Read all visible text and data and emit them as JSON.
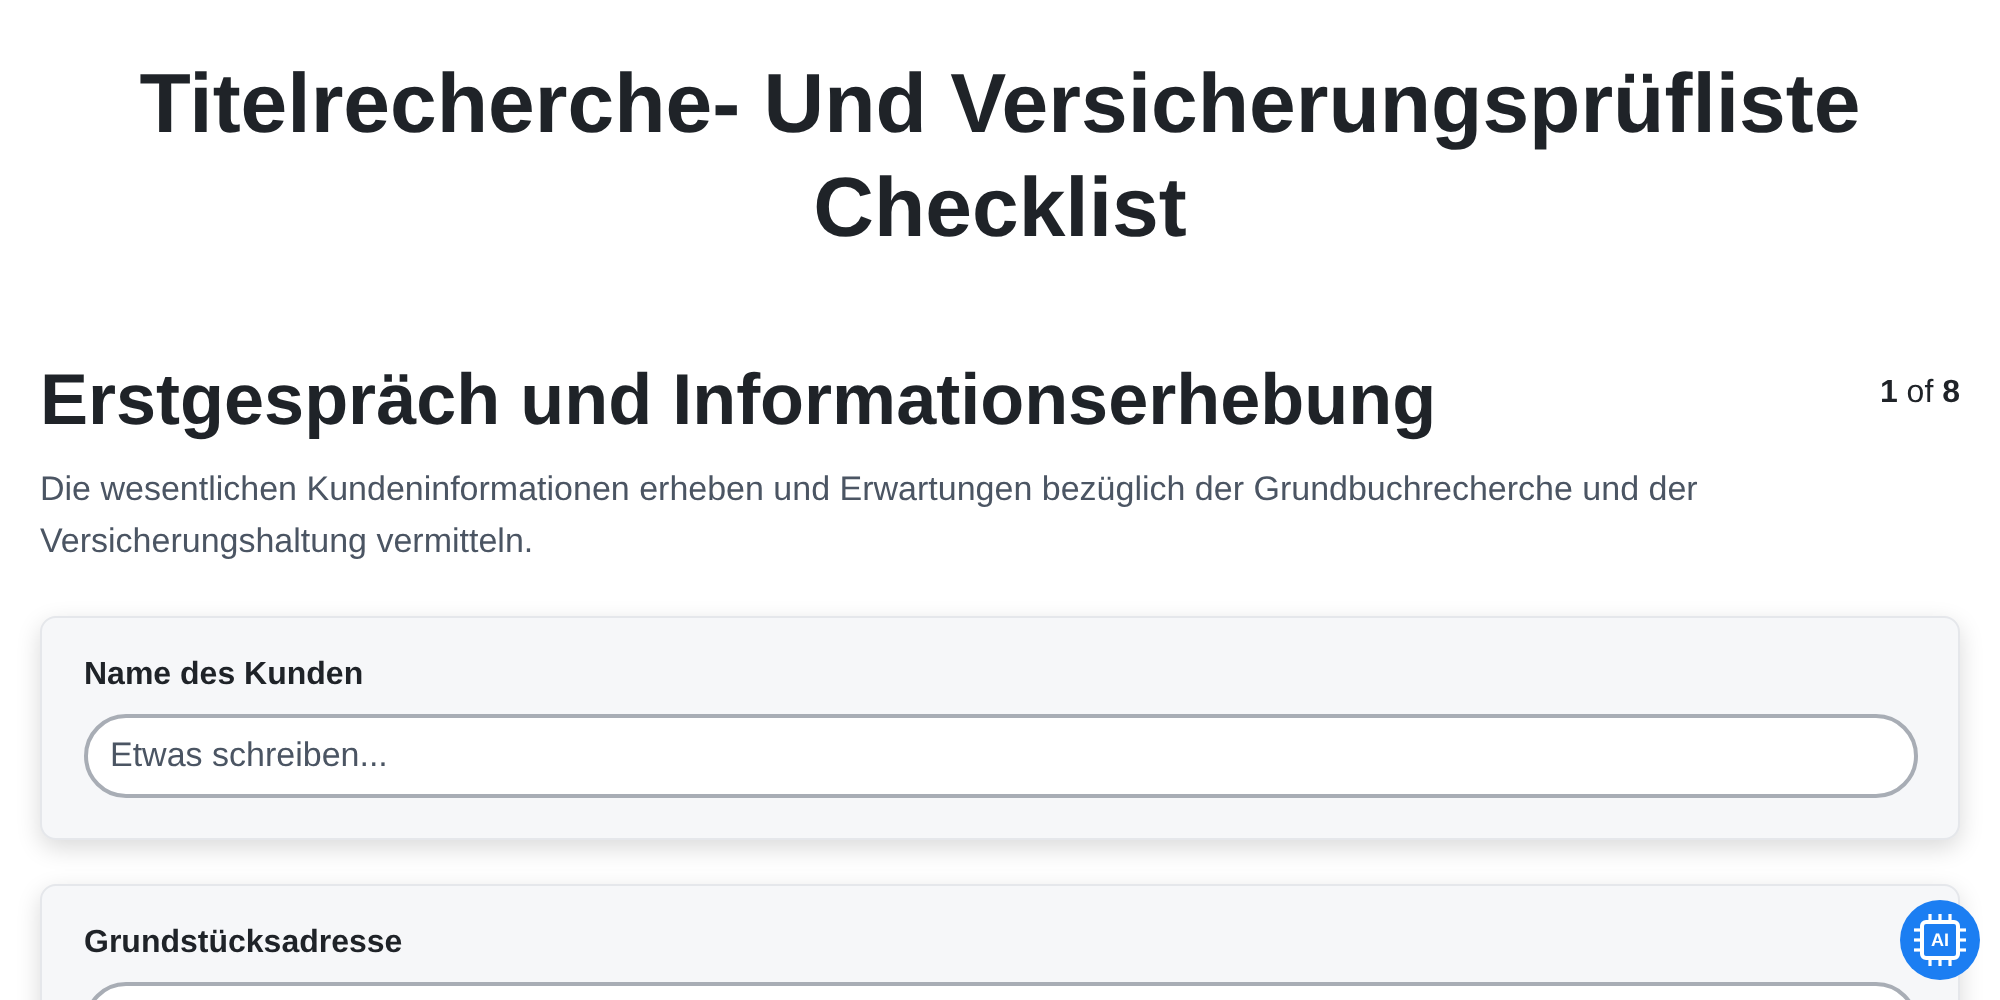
{
  "title": "Titelrecherche- Und Versicherungsprüfliste Checklist",
  "section": {
    "heading": "Erstgespräch und Informationserhebung",
    "page_counter": "**1** of **8**",
    "description": "Die wesentlichen Kundeninformationen erheben und Erwartungen bezüglich der Grundbuchrecherche und der Versicherungshaltung vermitteln."
  },
  "fields": [
    {
      "label": "Name des Kunden",
      "placeholder": "Etwas schreiben..."
    },
    {
      "label": "Grundstücksadresse"
    }
  ],
  "ai_button": {
    "label": "AI"
  }
}
